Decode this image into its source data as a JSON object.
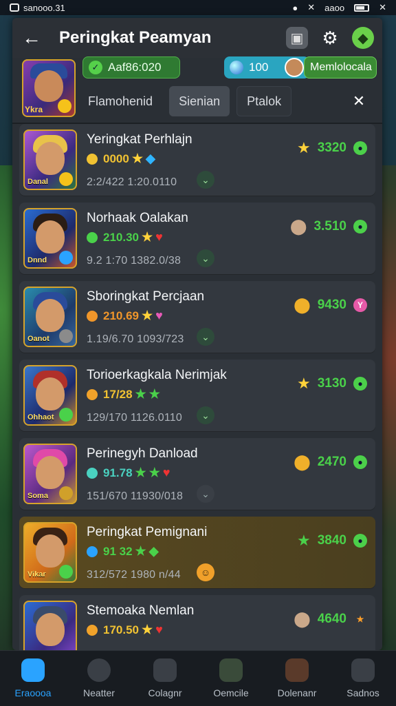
{
  "statusbar": {
    "time": "sanooo.31",
    "right_text": "aaoo"
  },
  "header": {
    "title": "Peringkat Peamyan"
  },
  "profile": {
    "id": "Aaf86:020",
    "coins": "100",
    "mode": "Memlolocala",
    "avatar_tag": "Ykra"
  },
  "tabs": [
    {
      "label": "Flamohenid"
    },
    {
      "label": "Sienian"
    },
    {
      "label": "Ptalok"
    }
  ],
  "rows": [
    {
      "name": "Yeringkat Perhlajn",
      "meta": "0000",
      "sub": "2:2/422 1:20.0110",
      "avatar_tag": "Danal",
      "score": "3320",
      "end": "star-green",
      "right_icon": "star"
    },
    {
      "name": "Norhaak Oalakan",
      "meta": "210.30",
      "sub": "9.2 1:70 1382.0/38",
      "avatar_tag": "Dnnd",
      "score": "3.510",
      "end": "green",
      "right_icon": "drop"
    },
    {
      "name": "Sboringkat Percjaan",
      "meta": "210.69",
      "sub": "1.19/6.70 1093/723",
      "avatar_tag": "Oanot",
      "score": "9430",
      "end": "pink",
      "right_icon": "drop-gold"
    },
    {
      "name": "Torioerkagkala Nerimjak",
      "meta": "17/28",
      "sub": "129/170 1126.0110",
      "avatar_tag": "Ohhaot",
      "score": "3130",
      "end": "green",
      "right_icon": "star"
    },
    {
      "name": "Perinegyh Danload",
      "meta": "91.78",
      "sub": "151/670 11930/018",
      "avatar_tag": "Soma",
      "score": "2470",
      "end": "green",
      "right_icon": "drop-gold"
    },
    {
      "name": "Peringkat Pemignani",
      "meta": "91 32",
      "sub": "312/572 1980 n/44",
      "avatar_tag": "Vikar",
      "score": "3840",
      "end": "green",
      "right_icon": "star-green",
      "highlight": true
    },
    {
      "name": "Stemoaka Nemlan",
      "meta": "170.50",
      "sub": "",
      "avatar_tag": "",
      "score": "4640",
      "end": "star",
      "right_icon": "drop"
    }
  ],
  "nav": [
    {
      "label": "Eraoooa"
    },
    {
      "label": "Neatter"
    },
    {
      "label": "Colagnr"
    },
    {
      "label": "Oemcile"
    },
    {
      "label": "Dolenanr"
    },
    {
      "label": "Sadnos"
    }
  ],
  "colors": {
    "accent": "#2aa3ff",
    "score_green": "#4ad14a"
  }
}
